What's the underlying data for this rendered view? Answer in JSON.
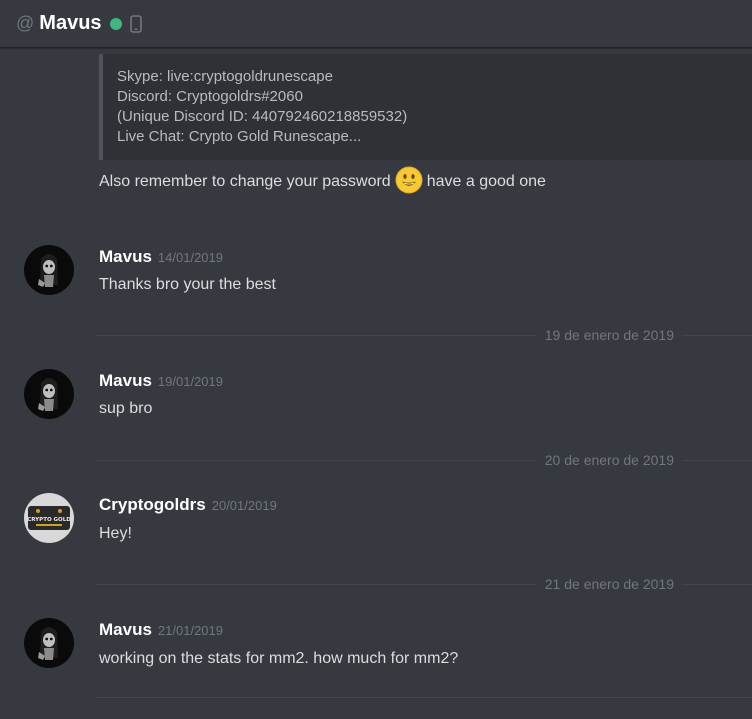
{
  "header": {
    "at_symbol": "@",
    "username": "Mavus",
    "status": "online",
    "status_color": "#43b581",
    "device_icon": "mobile-phone-icon"
  },
  "embed": {
    "lines": [
      "Skype: live:cryptogoldrunescape",
      "Discord: Cryptogoldrs#2060",
      "(Unique Discord ID: 440792460218859532)",
      "Live Chat: Crypto Gold Runescape..."
    ]
  },
  "continuation": {
    "before_emoji": "Also remember to change your password",
    "emoji": "smiley-emoji",
    "after_emoji": "have a good one"
  },
  "messages": [
    {
      "author": "Mavus",
      "timestamp": "14/01/2019",
      "text": "Thanks bro your the best",
      "avatar": "mavus-avatar"
    },
    {
      "author": "Mavus",
      "timestamp": "19/01/2019",
      "text": "sup bro",
      "avatar": "mavus-avatar"
    },
    {
      "author": "Cryptogoldrs",
      "timestamp": "20/01/2019",
      "text": "Hey!",
      "avatar": "cryptogold-avatar"
    },
    {
      "author": "Mavus",
      "timestamp": "21/01/2019",
      "text": "working on the stats for mm2. how much for mm2?",
      "avatar": "mavus-avatar"
    }
  ],
  "dividers": [
    "19 de enero de 2019",
    "20 de enero de 2019",
    "21 de enero de 2019"
  ],
  "avatar_logo_text": "CRYPTO GOLD"
}
